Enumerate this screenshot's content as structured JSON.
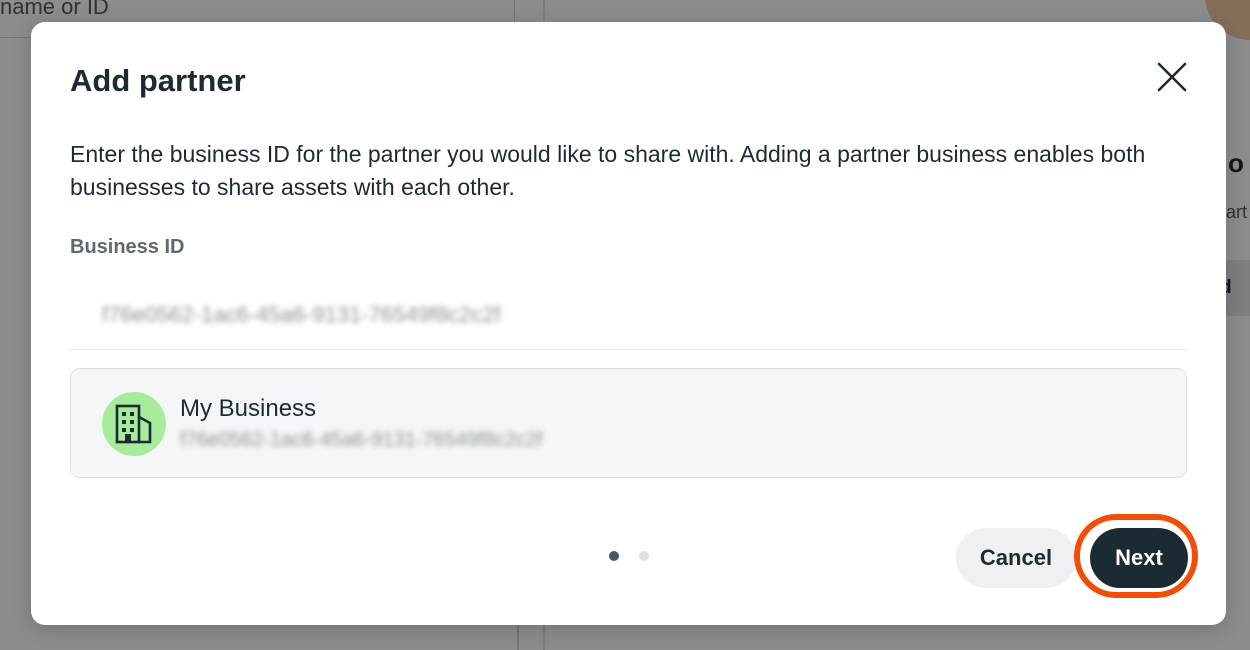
{
  "background": {
    "search_placeholder": "name or ID",
    "heading_fragment": "o",
    "subtext_fragment": "art",
    "button_fragment": "d"
  },
  "dialog": {
    "title": "Add partner",
    "description": "Enter the business ID for the partner you would like to share with. Adding a partner business enables both businesses to share assets with each other.",
    "field_label": "Business ID",
    "input_value": "f76e0562-1ac6-45a6-9131-76549f8c2c2f",
    "business": {
      "name": "My Business",
      "id": "f76e0562-1ac6-45a6-9131-76549f8c2c2f",
      "icon": "building-icon",
      "avatar_color": "#a6ec9a"
    },
    "pager": {
      "current": 1,
      "total": 2
    },
    "cancel_label": "Cancel",
    "next_label": "Next",
    "close_icon": "close-icon"
  },
  "colors": {
    "primary_button": "#1c2b33",
    "highlight": "#f24e0a",
    "text": "#1c2b33"
  }
}
